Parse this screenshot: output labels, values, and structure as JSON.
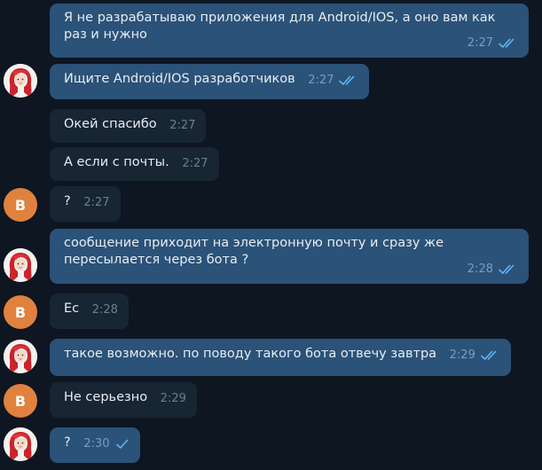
{
  "messages": [
    {
      "text": "Я не разрабатываю приложения для Android/IOS, а оно вам как раз и нужно",
      "time": "2:27",
      "direction": "out",
      "status": "read"
    },
    {
      "text": "Ищите Android/IOS разработчиков",
      "time": "2:27",
      "direction": "out",
      "status": "read"
    },
    {
      "text": "Окей спасибо",
      "time": "2:27",
      "direction": "in"
    },
    {
      "text": "А если с почты.",
      "time": "2:27",
      "direction": "in"
    },
    {
      "text": "?",
      "time": "2:27",
      "direction": "in"
    },
    {
      "text": "сообщение приходит на электронную почту и сразу же пересылается через бота ?",
      "time": "2:28",
      "direction": "out",
      "status": "read"
    },
    {
      "text": "Ес",
      "time": "2:28",
      "direction": "in"
    },
    {
      "text": "такое возможно. по поводу такого бота отвечу завтра",
      "time": "2:29",
      "direction": "out",
      "status": "read"
    },
    {
      "text": "Не серьезно",
      "time": "2:29",
      "direction": "in"
    },
    {
      "text": "?",
      "time": "2:30",
      "direction": "out",
      "status": "sent"
    }
  ],
  "sender_avatar_letter": "В",
  "icons": {
    "read": "double-check-icon",
    "sent": "single-check-icon",
    "own_avatar": "red-haired-girl-avatar-icon"
  },
  "colors": {
    "background": "#0e1621",
    "outgoing_bubble": "#2b5278",
    "incoming_bubble": "#182533",
    "check": "#5eb5f7",
    "letter_avatar": "#e0823d"
  }
}
